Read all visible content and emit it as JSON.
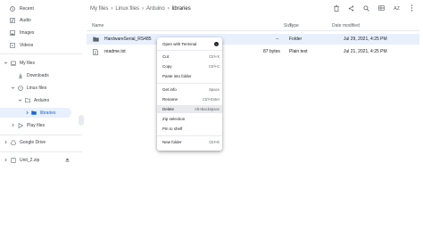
{
  "sidebar": {
    "recent": "Recent",
    "audio": "Audio",
    "images": "Images",
    "videos": "Videos",
    "my_files": "My files",
    "downloads": "Downloads",
    "linux_files": "Linux files",
    "arduino": "Arduino",
    "libraries": "libraries",
    "play_files": "Play files",
    "google_drive": "Google Drive",
    "usb": "Unit_2.zip"
  },
  "breadcrumb": {
    "items": [
      "My files",
      "Linux files",
      "Arduino"
    ],
    "current": "libraries",
    "separator": "›"
  },
  "toolbar": {
    "icons": [
      "delete-icon",
      "share-icon",
      "search-icon",
      "view-icon",
      "sort-icon",
      "more-icon"
    ],
    "sort_label": "AZ"
  },
  "list": {
    "headers": {
      "name": "Name",
      "size": "Size",
      "type": "Type",
      "date": "Date modified"
    },
    "rows": [
      {
        "name": "HardwareSerial_RS485",
        "size": "--",
        "type": "Folder",
        "date": "Jul 29, 2021, 4:25 PM"
      },
      {
        "name": "readme.txt",
        "size": "87 bytes",
        "type": "Plain text",
        "date": "Jul 21, 2021, 4:25 PM"
      }
    ]
  },
  "context_menu": {
    "items": [
      {
        "label": "Open with Terminal",
        "shortcut": ""
      },
      {
        "label": "Cut",
        "shortcut": "Ctrl+X"
      },
      {
        "label": "Copy",
        "shortcut": "Ctrl+C"
      },
      {
        "label": "Paste into folder",
        "shortcut": ""
      },
      {
        "label": "Get info",
        "shortcut": "Space"
      },
      {
        "label": "Rename",
        "shortcut": "Ctrl+Enter"
      },
      {
        "label": "Delete",
        "shortcut": "Alt+Backspace"
      },
      {
        "label": "Zip selection",
        "shortcut": ""
      },
      {
        "label": "Pin to shelf",
        "shortcut": ""
      },
      {
        "label": "New folder",
        "shortcut": "Ctrl+E"
      }
    ]
  },
  "colors": {
    "accent": "#1a73e8",
    "selected_bg": "#e8f0fe",
    "hover_bg": "#e8eaed",
    "folder_icon": "#5f6368"
  }
}
